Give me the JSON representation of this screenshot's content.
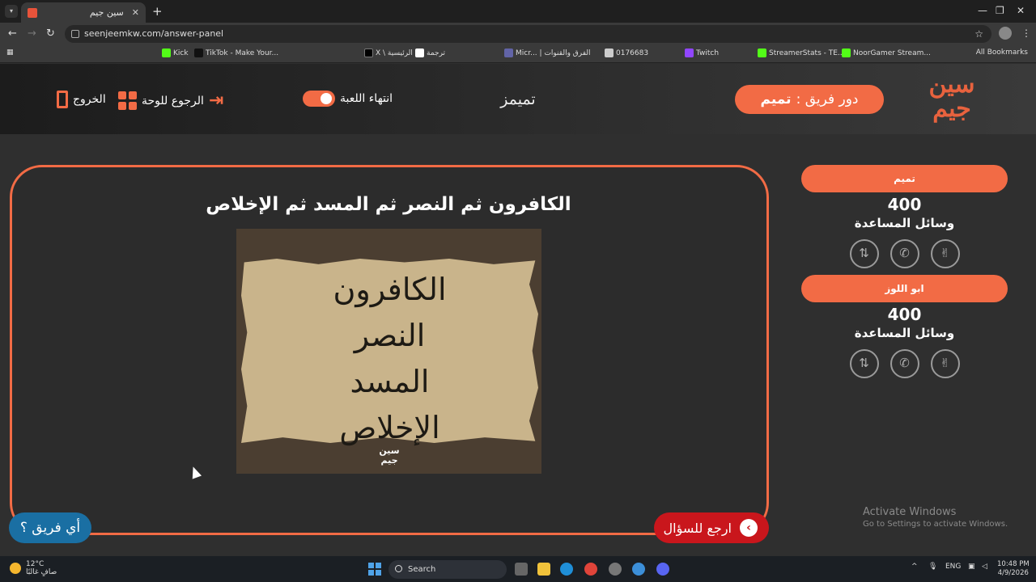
{
  "browser": {
    "tab_title": "سين جيم",
    "url": "seenjeemkw.com/answer-panel",
    "bookmarks": [
      "Kick",
      "TikTok - Make Your...",
      "X \\ الرئيسية",
      "ترجمة",
      "Micr... | الفرق والقنوات",
      "0176683",
      "Twitch",
      "StreamerStats - TE...",
      "NoorGamer Stream..."
    ],
    "all_bookmarks": "All Bookmarks"
  },
  "header": {
    "logo": "سين جيم",
    "turn_prefix": "دور فريق :",
    "turn_team": "تميم",
    "question_title": "تميمز",
    "end_game": "انتهاء اللعبة",
    "back_to_board": "الرجوع للوحة",
    "exit": "الخروج"
  },
  "main": {
    "answer": "الكافرون ثم النصر ثم المسد ثم الإخلاص",
    "image_lines": [
      "الكافرون",
      "النصر",
      "المسد",
      "الإخلاص"
    ],
    "image_logo": "سين جيم",
    "back_to_question": "ارجع للسؤال",
    "which_team": "أي فريق ؟"
  },
  "teams": [
    {
      "name": "تميم",
      "score": "400",
      "help_label": "وسائل المساعدة"
    },
    {
      "name": "ابو اللوز",
      "score": "400",
      "help_label": "وسائل المساعدة"
    }
  ],
  "windows": {
    "activate_title": "Activate Windows",
    "activate_sub": "Go to Settings to activate Windows."
  },
  "taskbar": {
    "temp": "12°C",
    "weather": "صافٍ غالبًا",
    "search": "Search",
    "lang": "ENG",
    "time": "10:48 PM",
    "date": "4/9/2026"
  },
  "colors": {
    "accent": "#f26b45",
    "red_button": "#c9161c",
    "blue_button": "#1a6fa3"
  }
}
